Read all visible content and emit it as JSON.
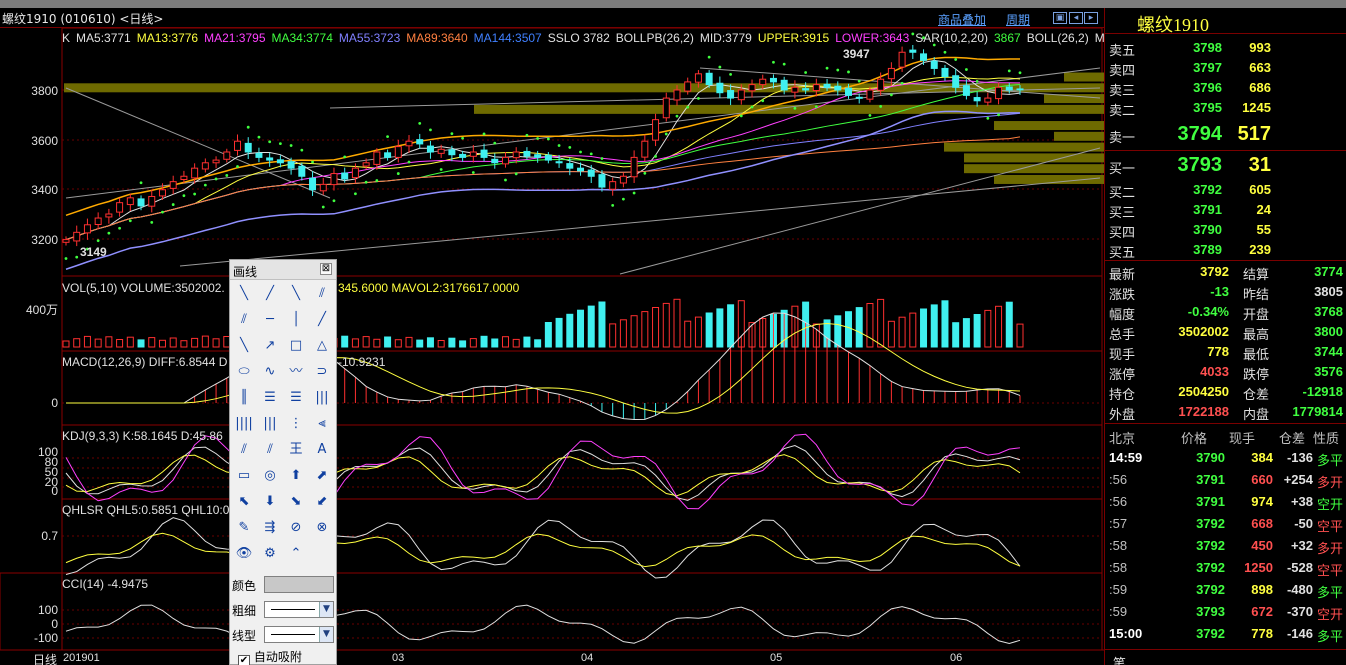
{
  "window": {
    "title": "螺纹1910 (010610) <日线>",
    "link_overlay": "商品叠加",
    "link_cycle": "周期"
  },
  "price_panel": {
    "ma_legend": [
      {
        "text": "K",
        "color": "#e0e0e0"
      },
      {
        "text": "MA5:3771",
        "color": "#e0e0e0"
      },
      {
        "text": "MA13:3776",
        "color": "#ffff40"
      },
      {
        "text": "MA21:3795",
        "color": "#ff40ff"
      },
      {
        "text": "MA34:3774",
        "color": "#40ff40"
      },
      {
        "text": "MA55:3723",
        "color": "#8080ff"
      },
      {
        "text": "MA89:3640",
        "color": "#ff8040"
      },
      {
        "text": "MA144:3507",
        "color": "#4080ff"
      },
      {
        "text": "SSLO 3782",
        "color": "#e0e0e0"
      },
      {
        "text": "BOLLPB(26,2)",
        "color": "#e0e0e0"
      },
      {
        "text": "MID:3779",
        "color": "#e0e0e0"
      },
      {
        "text": "UPPER:3915",
        "color": "#ffff40"
      },
      {
        "text": "LOWER:3643",
        "color": "#ff40ff"
      },
      {
        "text": "SAR(10,2,20)",
        "color": "#e0e0e0"
      },
      {
        "text": "3867",
        "color": "#40ff40"
      },
      {
        "text": "BOLL(26,2)",
        "color": "#e0e0e0"
      },
      {
        "text": "M",
        "color": "#e0e0e0"
      }
    ],
    "y_labels": [
      "3800",
      "3600",
      "3400",
      "3200"
    ],
    "high_label": "3947",
    "low_label": "3149"
  },
  "volume_panel": {
    "legend": "VOL(5,10) VOLUME:3502002.",
    "legend2": "345.6000 MAVOL2:3176617.0000",
    "y_label": "400万"
  },
  "macd_panel": {
    "legend": "MACD(12,26,9) DIFF:6.8544 D",
    "legend2": "-10.9231",
    "y_label": "0"
  },
  "kdj_panel": {
    "legend": "KDJ(9,3,3) K:58.1645 D:45.86",
    "y_labels": [
      "100",
      "80",
      "50",
      "20",
      "0"
    ]
  },
  "qhlsr_panel": {
    "legend": "QHLSR QHL5:0.5851 QHL10:0",
    "y_label": "0.7"
  },
  "cci_panel": {
    "legend": "CCI(14) -4.9475",
    "y_labels": [
      "100",
      "0",
      "-100"
    ]
  },
  "x_axis": {
    "period_label": "日线",
    "labels": [
      "201901",
      "03",
      "04",
      "05",
      "06"
    ]
  },
  "draw_tool": {
    "title": "画线",
    "close": "⊠",
    "tools": [
      "╲",
      "╱",
      "╲",
      "⫽",
      "⫽",
      "─",
      "│",
      "╱",
      "╲",
      "↗",
      "□",
      "△",
      "⬭",
      "∿",
      "〰",
      "⊃",
      "║",
      "☰",
      "☰",
      "|||",
      "||||",
      "|||",
      "⋮",
      "⫷",
      "⫽",
      "⫽",
      "王",
      "A",
      "▭",
      "◎",
      "⬆",
      "⬈",
      "⬉",
      "⬇",
      "⬊",
      "⬋",
      "✎",
      "⇶",
      "⊘",
      "⊗",
      "👁",
      "⚙",
      "⌃"
    ],
    "color_label": "颜色",
    "thickness_label": "粗细",
    "linetype_label": "线型",
    "auto_snap_label": "自动吸附",
    "auto_snap_checked": true
  },
  "quote": {
    "name": "螺纹1910",
    "sell": [
      {
        "label": "卖五",
        "price": "3798",
        "vol": "993"
      },
      {
        "label": "卖四",
        "price": "3797",
        "vol": "663"
      },
      {
        "label": "卖三",
        "price": "3796",
        "vol": "686"
      },
      {
        "label": "卖二",
        "price": "3795",
        "vol": "1245"
      },
      {
        "label": "卖一",
        "price": "3794",
        "vol": "517"
      }
    ],
    "buy": [
      {
        "label": "买一",
        "price": "3793",
        "vol": "31"
      },
      {
        "label": "买二",
        "price": "3792",
        "vol": "605"
      },
      {
        "label": "买三",
        "price": "3791",
        "vol": "24"
      },
      {
        "label": "买四",
        "price": "3790",
        "vol": "55"
      },
      {
        "label": "买五",
        "price": "3789",
        "vol": "239"
      }
    ],
    "stats": [
      {
        "l1": "最新",
        "v1": "3792",
        "c1": "yel",
        "l2": "结算",
        "v2": "3774",
        "c2": "grn"
      },
      {
        "l1": "涨跌",
        "v1": "-13",
        "c1": "grn",
        "l2": "昨结",
        "v2": "3805",
        "c2": "wht"
      },
      {
        "l1": "幅度",
        "v1": "-0.34%",
        "c1": "grn",
        "l2": "开盘",
        "v2": "3768",
        "c2": "grn"
      },
      {
        "l1": "总手",
        "v1": "3502002",
        "c1": "yel",
        "l2": "最高",
        "v2": "3800",
        "c2": "grn"
      },
      {
        "l1": "现手",
        "v1": "778",
        "c1": "yel",
        "l2": "最低",
        "v2": "3744",
        "c2": "grn"
      },
      {
        "l1": "涨停",
        "v1": "4033",
        "c1": "red",
        "l2": "跌停",
        "v2": "3576",
        "c2": "grn"
      },
      {
        "l1": "持仓",
        "v1": "2504250",
        "c1": "yel",
        "l2": "仓差",
        "v2": "-12918",
        "c2": "grn"
      },
      {
        "l1": "外盘",
        "v1": "1722188",
        "c1": "red",
        "l2": "内盘",
        "v2": "1779814",
        "c2": "grn"
      }
    ],
    "tick_header": {
      "time": "北京",
      "price": "价格",
      "vol": "现手",
      "oi": "仓差",
      "nature": "性质"
    },
    "ticks": [
      {
        "time": "14:59",
        "price": "3790",
        "pc": "grn",
        "vol": "384",
        "vc": "yel",
        "oi": "-136",
        "oc": "wht",
        "nature": "多平",
        "nc": "grn"
      },
      {
        "time": ":56",
        "price": "3791",
        "pc": "grn",
        "vol": "660",
        "vc": "red",
        "oi": "+254",
        "oc": "wht",
        "nature": "多开",
        "nc": "red"
      },
      {
        "time": ":56",
        "price": "3791",
        "pc": "grn",
        "vol": "974",
        "vc": "yel",
        "oi": "+38",
        "oc": "wht",
        "nature": "空开",
        "nc": "grn"
      },
      {
        "time": ":57",
        "price": "3792",
        "pc": "grn",
        "vol": "668",
        "vc": "red",
        "oi": "-50",
        "oc": "wht",
        "nature": "空平",
        "nc": "red"
      },
      {
        "time": ":58",
        "price": "3792",
        "pc": "grn",
        "vol": "450",
        "vc": "red",
        "oi": "+32",
        "oc": "wht",
        "nature": "多开",
        "nc": "red"
      },
      {
        "time": ":58",
        "price": "3792",
        "pc": "grn",
        "vol": "1250",
        "vc": "red",
        "oi": "-528",
        "oc": "wht",
        "nature": "空平",
        "nc": "red"
      },
      {
        "time": ":59",
        "price": "3792",
        "pc": "grn",
        "vol": "898",
        "vc": "yel",
        "oi": "-480",
        "oc": "wht",
        "nature": "多平",
        "nc": "grn"
      },
      {
        "time": ":59",
        "price": "3793",
        "pc": "grn",
        "vol": "672",
        "vc": "red",
        "oi": "-370",
        "oc": "wht",
        "nature": "空开",
        "nc": "red"
      },
      {
        "time": "15:00",
        "price": "3792",
        "pc": "grn",
        "vol": "778",
        "vc": "yel",
        "oi": "-146",
        "oc": "wht",
        "nature": "多平",
        "nc": "grn"
      }
    ],
    "bottom_tab": "笔"
  },
  "chart_data": {
    "type": "candlestick",
    "x_axis_labels": [
      "201901",
      "03",
      "04",
      "05",
      "06"
    ],
    "close": [
      3235,
      3262,
      3290,
      3315,
      3330,
      3372,
      3390,
      3360,
      3395,
      3420,
      3450,
      3470,
      3500,
      3520,
      3530,
      3560,
      3600,
      3560,
      3540,
      3530,
      3520,
      3500,
      3470,
      3420,
      3440,
      3480,
      3460,
      3500,
      3520,
      3560,
      3540,
      3580,
      3600,
      3590,
      3560,
      3570,
      3550,
      3540,
      3560,
      3540,
      3520,
      3540,
      3560,
      3545,
      3540,
      3530,
      3520,
      3500,
      3490,
      3470,
      3430,
      3450,
      3470,
      3540,
      3600,
      3680,
      3760,
      3790,
      3820,
      3850,
      3810,
      3780,
      3760,
      3790,
      3810,
      3830,
      3820,
      3790,
      3800,
      3790,
      3810,
      3800,
      3790,
      3770,
      3760,
      3790,
      3830,
      3870,
      3930,
      3930,
      3900,
      3870,
      3840,
      3800,
      3770,
      3750,
      3760,
      3800,
      3790,
      3792
    ],
    "high_marker": 3947,
    "low_marker": 3149,
    "ylim": [
      3100,
      4020
    ]
  }
}
